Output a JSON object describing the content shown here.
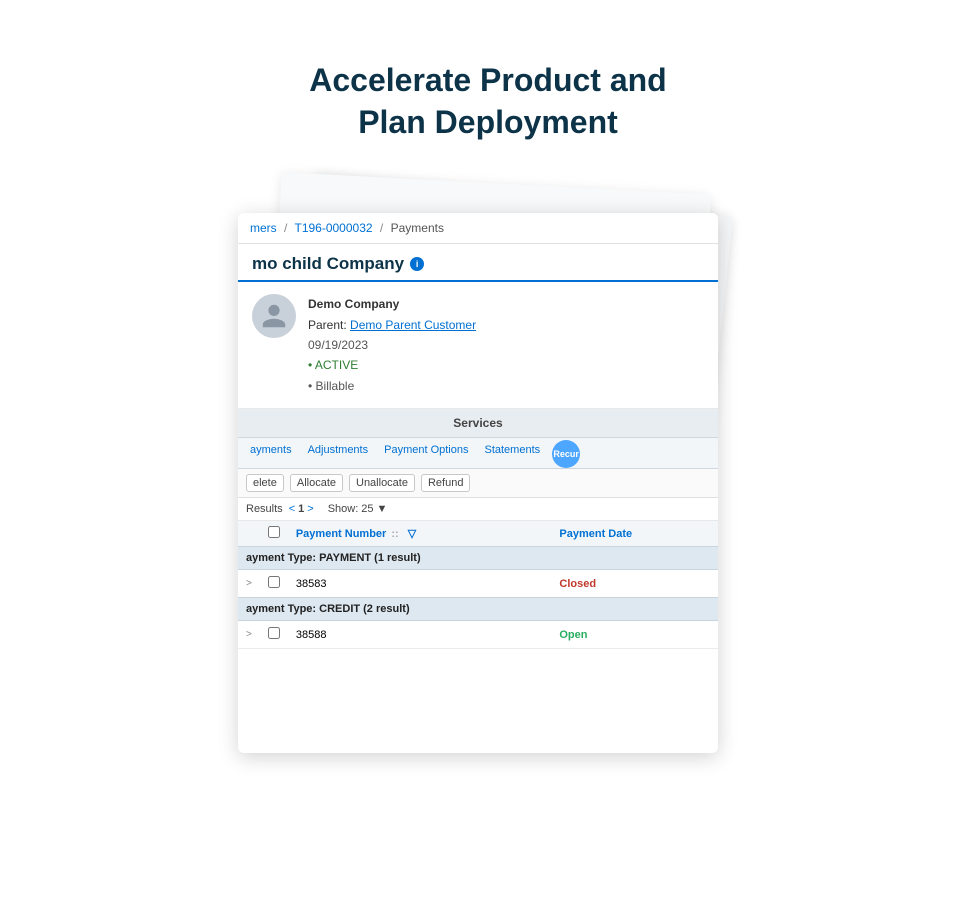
{
  "page": {
    "title_line1": "Accelerate Product and",
    "title_line2": "Plan Deployment"
  },
  "breadcrumb": {
    "customers_label": "mers",
    "invoice_id": "T196-0000032",
    "current": "Payments"
  },
  "card": {
    "header_title": "mo child Company",
    "info_icon_label": "i",
    "company_name": "Demo Company",
    "parent_label": "Parent:",
    "parent_link": "Demo Parent Customer",
    "date": "09/19/2023",
    "status_active": "ACTIVE",
    "status_billable": "Billable"
  },
  "services_header": "Services",
  "tabs": [
    {
      "label": "ayments",
      "active": false
    },
    {
      "label": "Adjustments",
      "active": false
    },
    {
      "label": "Payment Options",
      "active": false
    },
    {
      "label": "Statements",
      "active": false
    },
    {
      "label": "Recur",
      "active": false,
      "is_circle": true
    }
  ],
  "actions": [
    {
      "label": "elete"
    },
    {
      "label": "Allocate"
    },
    {
      "label": "Unallocate"
    },
    {
      "label": "Refund"
    }
  ],
  "results_bar": {
    "results_label": "Results",
    "prev": "<",
    "page": "1",
    "next": ">",
    "show_label": "Show:",
    "show_value": "25",
    "dropdown_indicator": "▼"
  },
  "table": {
    "columns": [
      {
        "label": ""
      },
      {
        "label": ""
      },
      {
        "label": "Payment Number"
      },
      {
        "label": "::"
      },
      {
        "label": "▽"
      },
      {
        "label": "Payment Date"
      }
    ],
    "groups": [
      {
        "group_label": "ayment Type: PAYMENT (1 result)",
        "rows": [
          {
            "chevron": ">",
            "number": "38583",
            "status": "Closed",
            "status_type": "closed"
          }
        ]
      },
      {
        "group_label": "ayment Type: CREDIT (2 result)",
        "rows": [
          {
            "chevron": ">",
            "number": "38588",
            "status": "Open",
            "status_type": "open"
          }
        ]
      }
    ]
  }
}
